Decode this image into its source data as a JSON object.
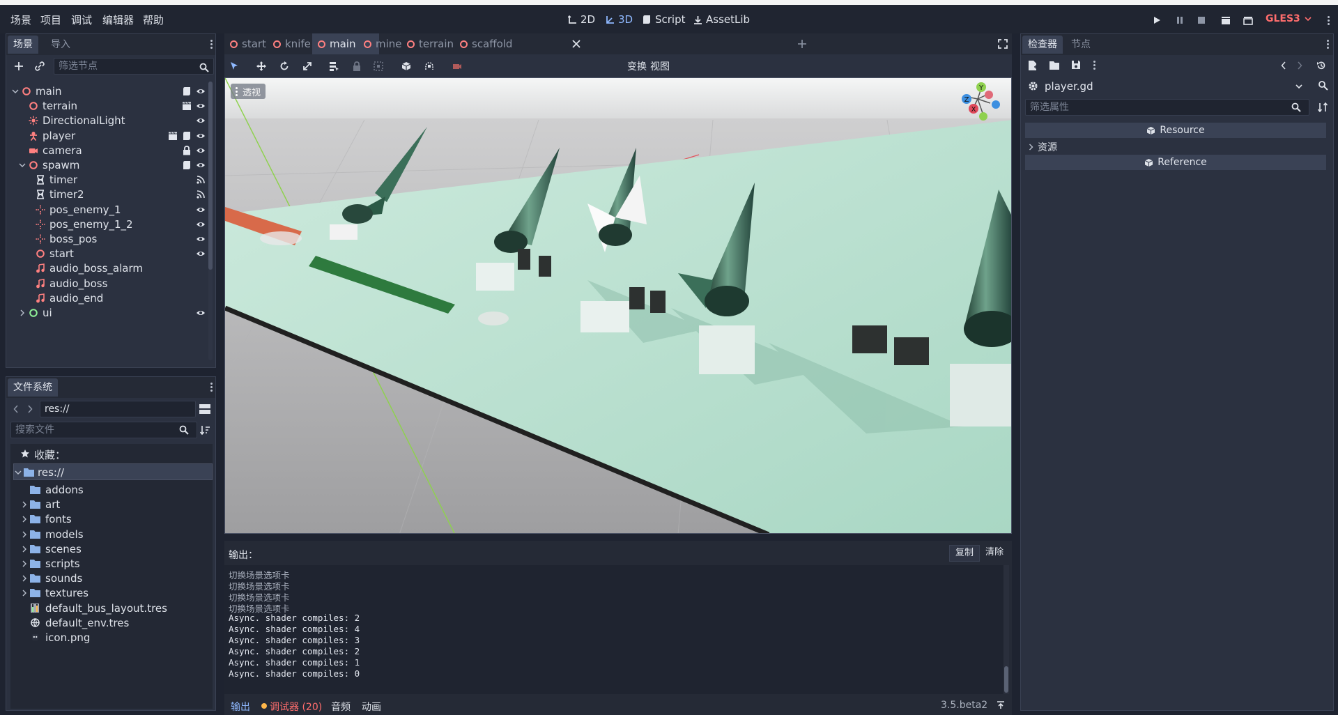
{
  "menubar": {
    "items": [
      "场景",
      "项目",
      "调试",
      "编辑器",
      "帮助"
    ],
    "workspaces": [
      {
        "label": "2D",
        "active": false
      },
      {
        "label": "3D",
        "active": true
      },
      {
        "label": "Script",
        "active": false
      },
      {
        "label": "AssetLib",
        "active": false
      }
    ],
    "renderer": "GLES3"
  },
  "scene_dock": {
    "tabs": [
      "场景",
      "导入"
    ],
    "filter_placeholder": "筛选节点",
    "nodes": [
      {
        "name": "main",
        "depth": 0,
        "expanded": true,
        "icon": "node-icon",
        "color": "#ff8080",
        "right": [
          "script-icon",
          "eye-icon"
        ]
      },
      {
        "name": "terrain",
        "depth": 1,
        "icon": "node-icon",
        "color": "#ff8080",
        "right": [
          "scene-icon",
          "eye-icon"
        ]
      },
      {
        "name": "DirectionalLight",
        "depth": 1,
        "icon": "light-icon",
        "color": "#ff8080",
        "right": [
          "eye-icon"
        ]
      },
      {
        "name": "player",
        "depth": 1,
        "icon": "player-icon",
        "color": "#ff8080",
        "right": [
          "scene-icon",
          "script-icon",
          "eye-icon"
        ]
      },
      {
        "name": "camera",
        "depth": 1,
        "icon": "camera-icon",
        "color": "#ff8080",
        "right": [
          "lock-icon",
          "eye-icon"
        ]
      },
      {
        "name": "spawm",
        "depth": 1,
        "expanded": true,
        "icon": "node-icon",
        "color": "#ff8080",
        "right": [
          "script-icon",
          "eye-icon"
        ]
      },
      {
        "name": "timer",
        "depth": 2,
        "icon": "timer-icon",
        "color": "#e2e6ee",
        "right": [
          "signal-icon"
        ]
      },
      {
        "name": "timer2",
        "depth": 2,
        "icon": "timer-icon",
        "color": "#e2e6ee",
        "right": [
          "signal-icon"
        ]
      },
      {
        "name": "pos_enemy_1",
        "depth": 2,
        "icon": "position-icon",
        "color": "#ff8080",
        "right": [
          "eye-icon"
        ]
      },
      {
        "name": "pos_enemy_1_2",
        "depth": 2,
        "icon": "position-icon",
        "color": "#ff8080",
        "right": [
          "eye-icon"
        ]
      },
      {
        "name": "boss_pos",
        "depth": 2,
        "icon": "position-icon",
        "color": "#ff8080",
        "right": [
          "eye-icon"
        ]
      },
      {
        "name": "start",
        "depth": 2,
        "icon": "node-icon",
        "color": "#ff8080",
        "right": [
          "eye-icon"
        ]
      },
      {
        "name": "audio_boss_alarm",
        "depth": 2,
        "icon": "audio-icon",
        "color": "#ff8080",
        "right": []
      },
      {
        "name": "audio_boss",
        "depth": 2,
        "icon": "audio-icon",
        "color": "#ff8080",
        "right": []
      },
      {
        "name": "audio_end",
        "depth": 2,
        "icon": "audio-icon",
        "color": "#ff8080",
        "right": []
      },
      {
        "name": "ui",
        "depth": 1,
        "collapsed": true,
        "icon": "node-icon",
        "color": "#8eef97",
        "right": [
          "eye-icon"
        ]
      }
    ]
  },
  "filesystem": {
    "tab": "文件系统",
    "path": "res://",
    "search_placeholder": "搜索文件",
    "favorites": "收藏：",
    "root": "res://",
    "items": [
      {
        "name": "addons",
        "type": "folder",
        "expandable": false
      },
      {
        "name": "art",
        "type": "folder",
        "expandable": true
      },
      {
        "name": "fonts",
        "type": "folder",
        "expandable": true
      },
      {
        "name": "models",
        "type": "folder",
        "expandable": true
      },
      {
        "name": "scenes",
        "type": "folder",
        "expandable": true
      },
      {
        "name": "scripts",
        "type": "folder",
        "expandable": true
      },
      {
        "name": "sounds",
        "type": "folder",
        "expandable": true
      },
      {
        "name": "textures",
        "type": "folder",
        "expandable": true
      },
      {
        "name": "default_bus_layout.tres",
        "type": "bus",
        "expandable": false
      },
      {
        "name": "default_env.tres",
        "type": "env",
        "expandable": false
      },
      {
        "name": "icon.png",
        "type": "image",
        "expandable": false
      }
    ]
  },
  "scene_tabs": [
    {
      "label": "start",
      "active": false
    },
    {
      "label": "knife",
      "active": false
    },
    {
      "label": "main",
      "active": true
    },
    {
      "label": "mine",
      "active": false
    },
    {
      "label": "terrain",
      "active": false
    },
    {
      "label": "scaffold",
      "active": false
    }
  ],
  "toolbar": {
    "transform_menu": "变换",
    "view_menu": "视图"
  },
  "viewport": {
    "perspective_label": "透视",
    "gizmo": {
      "y": "Y",
      "z": "Z",
      "x": "X"
    }
  },
  "output": {
    "title": "输出：",
    "copy": "复制",
    "clear": "清除",
    "lines": [
      "切换场景选项卡",
      "切换场景选项卡",
      "切换场景选项卡",
      "切换场景选项卡",
      "Async. shader compiles: 2",
      "Async. shader compiles: 4",
      "Async. shader compiles: 3",
      "Async. shader compiles: 2",
      "Async. shader compiles: 1",
      "Async. shader compiles: 0"
    ]
  },
  "bottom_bar": {
    "output": "输出",
    "debugger": "调试器 (20)",
    "audio": "音频",
    "animation": "动画",
    "version": "3.5.beta2"
  },
  "inspector": {
    "tabs": [
      "检查器",
      "节点"
    ],
    "resource_name": "player.gd",
    "filter_placeholder": "筛选属性",
    "sections": {
      "resource": "Resource",
      "res_group": "资源",
      "reference": "Reference"
    }
  },
  "colors": {
    "accent": "#8fb9ff",
    "node_red": "#ff8080",
    "node_green": "#8eef97",
    "renderer_red": "#ff6d6d",
    "folder": "#8db3e8"
  }
}
